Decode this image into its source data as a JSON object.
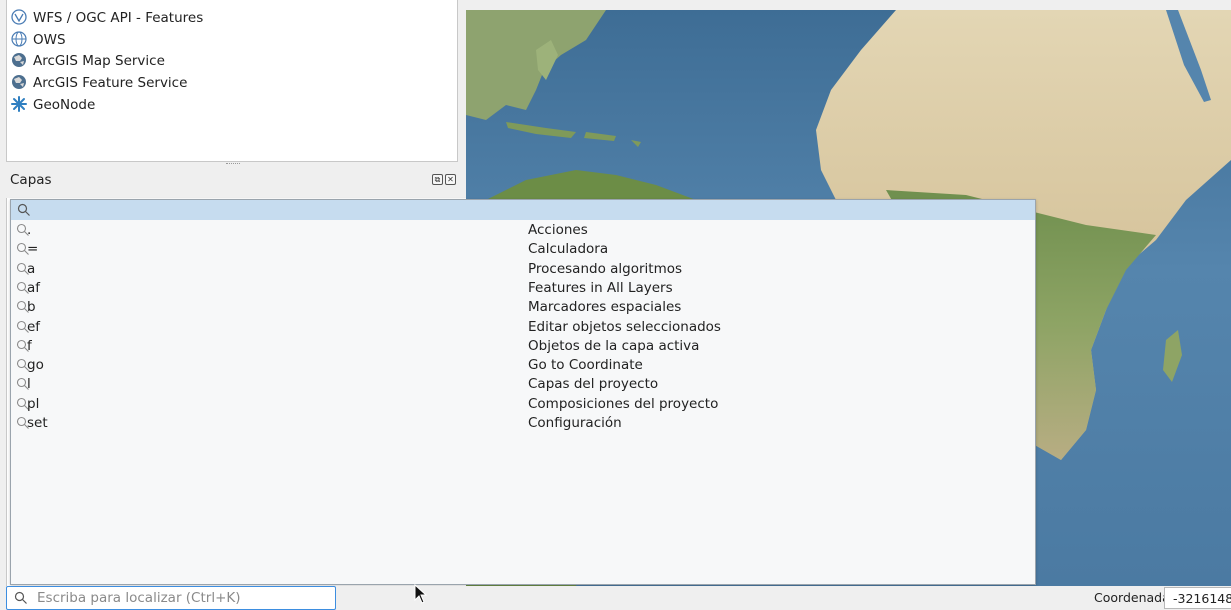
{
  "browser": {
    "items": [
      {
        "label": "WFS / OGC API - Features",
        "icon": "wfs-icon"
      },
      {
        "label": "OWS",
        "icon": "ows-globe-icon"
      },
      {
        "label": "ArcGIS Map Service",
        "icon": "arcgis-globe-icon"
      },
      {
        "label": "ArcGIS Feature Service",
        "icon": "arcgis-globe-icon"
      },
      {
        "label": "GeoNode",
        "icon": "geonode-icon"
      }
    ]
  },
  "layers": {
    "title": "Capas",
    "buttons": [
      "float-icon",
      "close-icon"
    ]
  },
  "locator": {
    "placeholder": "Escriba para localizar (Ctrl+K)",
    "query": "",
    "filters": [
      {
        "prefix": ".",
        "label": "Acciones"
      },
      {
        "prefix": "=",
        "label": "Calculadora"
      },
      {
        "prefix": "a",
        "label": "Procesando algoritmos"
      },
      {
        "prefix": "af",
        "label": "Features in All Layers"
      },
      {
        "prefix": "b",
        "label": "Marcadores espaciales"
      },
      {
        "prefix": "ef",
        "label": "Editar objetos seleccionados"
      },
      {
        "prefix": "f",
        "label": "Objetos de la capa activa"
      },
      {
        "prefix": "go",
        "label": "Go to Coordinate"
      },
      {
        "prefix": "l",
        "label": "Capas del proyecto"
      },
      {
        "prefix": "pl",
        "label": "Composiciones del proyecto"
      },
      {
        "prefix": "set",
        "label": "Configuración"
      }
    ]
  },
  "statusbar": {
    "coord_label": "Coordenada",
    "coord_value": "-3216148"
  },
  "colors": {
    "ocean": "#4f7fa7",
    "land_desert": "#d8c9a4",
    "land_green": "#8fa86a",
    "selection": "#c6dcef",
    "focus_border": "#3d8ee0"
  }
}
